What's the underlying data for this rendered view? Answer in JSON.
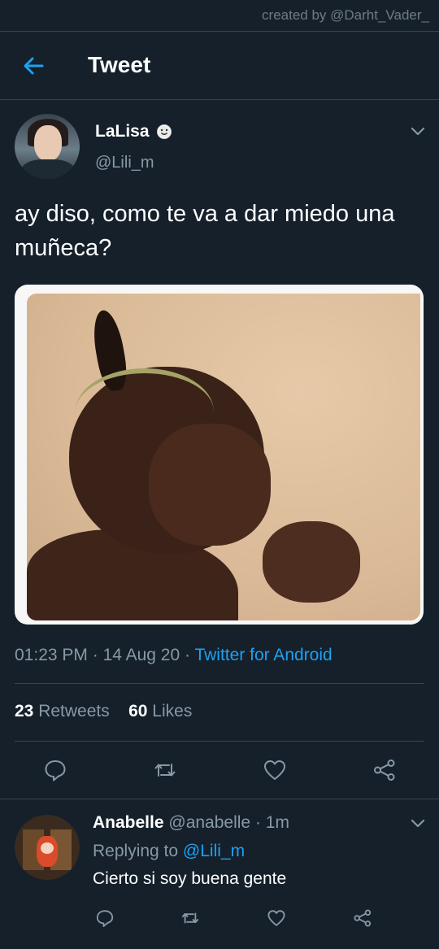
{
  "credit": "created by @Darht_Vader_",
  "header": {
    "title": "Tweet"
  },
  "tweet": {
    "display_name": "LaLisa",
    "handle": "@Lili_m",
    "text": "ay diso, como te va a dar miedo una muñeca?",
    "time": "01:23 PM",
    "date": "14 Aug 20",
    "client": "Twitter for Android",
    "retweet_count": "23",
    "retweet_label": "Retweets",
    "like_count": "60",
    "like_label": "Likes"
  },
  "reply": {
    "display_name": "Anabelle",
    "handle": "@anabelle",
    "age": "1m",
    "replying_prefix": "Replying to",
    "replying_to": "@Lili_m",
    "text": "Cierto si soy buena gente"
  },
  "icons": {
    "back": "arrow-left-icon",
    "menu": "chevron-down-icon",
    "reply": "comment-icon",
    "retweet": "retweet-icon",
    "like": "heart-icon",
    "share": "share-icon",
    "emoji": "smiling-face-icon"
  },
  "colors": {
    "background": "#15202b",
    "accent": "#1da1f2",
    "secondary_text": "#8899a6",
    "divider": "#38444d"
  }
}
